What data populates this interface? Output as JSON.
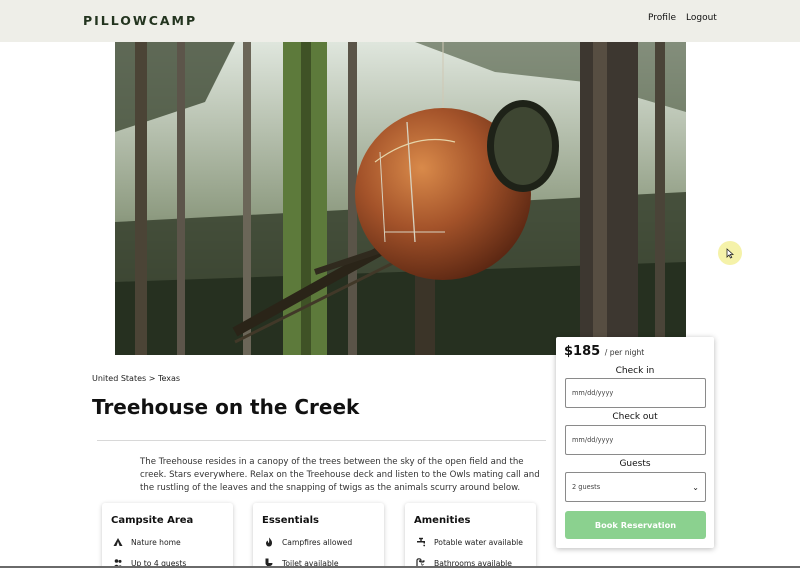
{
  "header": {
    "logo": "PILLOWCAMP",
    "nav": {
      "profile": "Profile",
      "logout": "Logout"
    }
  },
  "listing": {
    "breadcrumb": "United States > Texas",
    "title": "Treehouse on the Creek",
    "description": "The Treehouse resides in a canopy of the trees between the sky of the open field and the creek. Stars everywhere. Relax on the Treehouse deck and listen to the Owls mating call and the rustling of the leaves and the snapping of twigs as the animals scurry around below."
  },
  "cards": [
    {
      "title": "Campsite Area",
      "items": [
        {
          "icon": "tent-icon",
          "label": "Nature home"
        },
        {
          "icon": "users-icon",
          "label": "Up to 4 guests"
        }
      ]
    },
    {
      "title": "Essentials",
      "items": [
        {
          "icon": "fire-icon",
          "label": "Campfires allowed"
        },
        {
          "icon": "toilet-icon",
          "label": "Toilet available"
        }
      ]
    },
    {
      "title": "Amenities",
      "items": [
        {
          "icon": "faucet-icon",
          "label": "Potable water available"
        },
        {
          "icon": "shower-icon",
          "label": "Bathrooms available"
        }
      ]
    }
  ],
  "booking": {
    "price": "$185",
    "price_unit": "/ per night",
    "checkin_label": "Check in",
    "checkin_placeholder": "mm/dd/yyyy",
    "checkout_label": "Check out",
    "checkout_placeholder": "mm/dd/yyyy",
    "guests_label": "Guests",
    "guests_value": "2 guests",
    "button": "Book Reservation",
    "button_color": "#8bd18f"
  }
}
